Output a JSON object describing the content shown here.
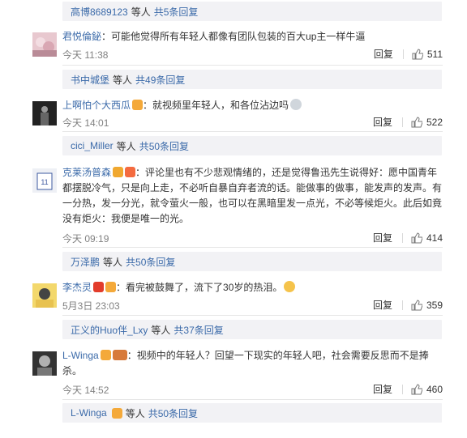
{
  "replies": [
    {
      "name": "高博8689123",
      "text": "等人",
      "more": "共5条回复"
    },
    {
      "name": "书中城堡",
      "text": "等人",
      "more": "共49条回复"
    },
    {
      "name": "cici_Miller",
      "text": "等人",
      "more": "共50条回复"
    },
    {
      "name": "万泽鹏",
      "text": "等人",
      "more": "共50条回复"
    },
    {
      "name": "正义的Huo伴_Lxy",
      "text": "等人",
      "more": "共37条回复"
    },
    {
      "name": "L-Winga",
      "text": "等人",
      "more": "共50条回复"
    }
  ],
  "comments": [
    {
      "user": "君悦倫鉍",
      "sep": "：",
      "text": "可能他觉得所有年轻人都像有团队包装的百大up主一样牛逼",
      "time": "今天 11:38",
      "reply": "回复",
      "likes": "511"
    },
    {
      "user": "上啊怕个大西瓜",
      "sep": "：",
      "text": "就视频里年轻人，和各位沾边吗",
      "time": "今天 14:01",
      "reply": "回复",
      "likes": "522"
    },
    {
      "user": "克莱汤普森",
      "sep": "：",
      "text_lines": [
        "评论里也有不少悲观情绪的，还是觉得鲁迅先生说得好：愿中国青年",
        "都摆脱冷气，只是向上走，不必听自暴自弃者流的话。能做事的做事，能发声的发声。有",
        "一分热，发一分光，就令萤火一般，也可以在黑暗里发一点光，不必等候炬火。此后如竟",
        "没有炬火：我便是唯一的光。"
      ],
      "time": "今天 09:19",
      "reply": "回复",
      "likes": "414"
    },
    {
      "user": "李杰灵",
      "sep": "：",
      "text": "看完被鼓舞了，流下了30岁的热泪。",
      "time": "5月3日 23:03",
      "reply": "回复",
      "likes": "359"
    },
    {
      "user": "L-Winga",
      "sep": "：",
      "text_lines": [
        "视频中的年轻人？回望一下现实的年轻人吧，社会需要反思而不是捧",
        "杀。"
      ],
      "time": "今天 14:52",
      "reply": "回复",
      "likes": "460"
    }
  ],
  "colors": {
    "link": "#3b6aa9",
    "reply_bg": "#f2f2f5",
    "meta": "#808080"
  }
}
